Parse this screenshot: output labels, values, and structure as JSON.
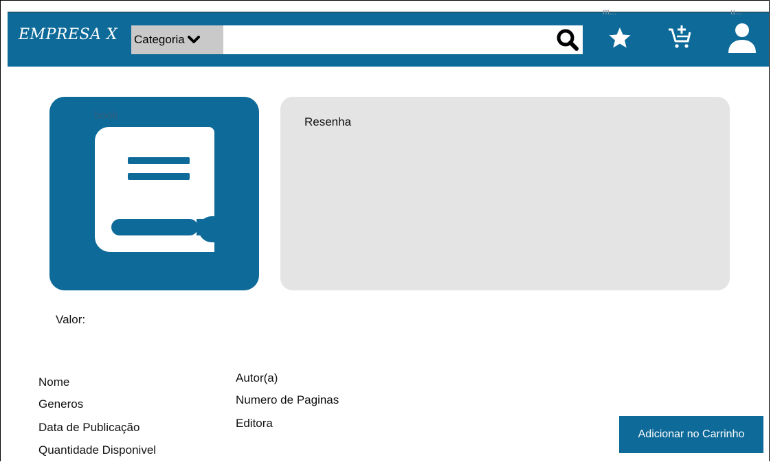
{
  "header": {
    "logo": "EMPRESA X",
    "category_label": "Categoria",
    "search": {
      "value": "",
      "placeholder": ""
    },
    "icons": {
      "search": "search-icon",
      "favorites": "star-icon",
      "favorites_label": "m...",
      "cart": "cart-add-icon",
      "user": "user-icon",
      "user_label": "u..."
    }
  },
  "product": {
    "image_label": "book",
    "image_icon": "book-icon",
    "review_title": "Resenha",
    "price_label": "Valor:",
    "details_left": [
      "Nome",
      "Generos",
      "Data de Publicação",
      "Quantidade Disponivel"
    ],
    "details_right": [
      "Autor(a)",
      "Numero de Paginas",
      "Editora"
    ],
    "add_to_cart_label": "Adicionar no Carrinho"
  },
  "colors": {
    "brand": "#0e6a98",
    "review_background": "#e4e4e4",
    "category_background": "#c9c9c9"
  }
}
